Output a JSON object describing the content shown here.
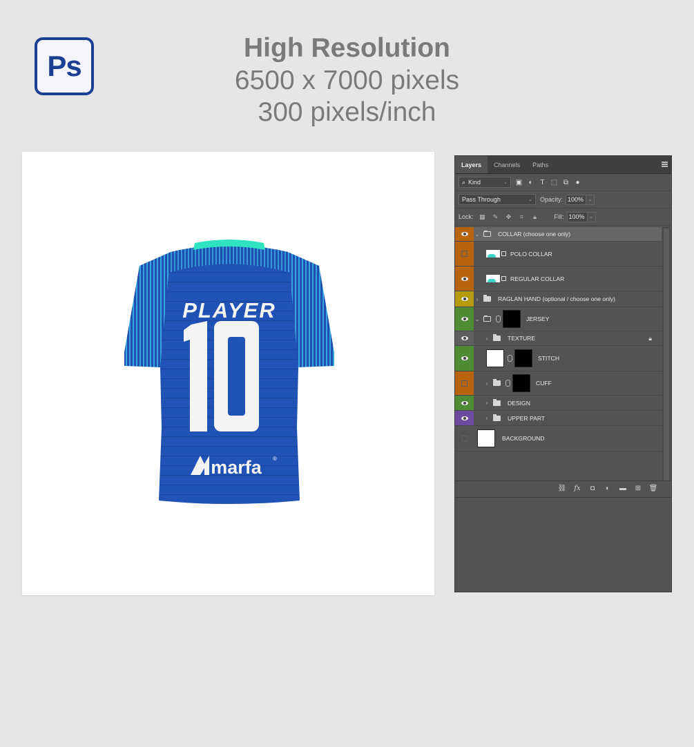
{
  "logo": {
    "text": "Ps",
    "color": "#1c3f94"
  },
  "headline": {
    "title": "High Resolution",
    "dimensions": "6500 x 7000 pixels",
    "resolution": "300 pixels/inch"
  },
  "jersey": {
    "name_text": "PLAYER",
    "number_text": "10",
    "brand_text": "marfa",
    "brand_mark": "®",
    "body_color": "#2050b4",
    "sleeve_color": "#2a7cc9",
    "collar_color": "#2fe3c0"
  },
  "layers_panel": {
    "tabs": [
      {
        "label": "Layers",
        "active": true
      },
      {
        "label": "Channels",
        "active": false
      },
      {
        "label": "Paths",
        "active": false
      }
    ],
    "filter": {
      "kind_label": "Kind"
    },
    "blend_mode": "Pass Through",
    "opacity_label": "Opacity:",
    "opacity_value": "100%",
    "lock_label": "Lock:",
    "fill_label": "Fill:",
    "fill_value": "100%",
    "layers": [
      {
        "name": "COLLAR (choose one only)",
        "visible": true,
        "tag_color": "#b8640c",
        "kind": "group-open",
        "selected": true
      },
      {
        "name": "POLO COLLAR",
        "visible": false,
        "tag_color": "#b8640c",
        "kind": "smart-object"
      },
      {
        "name": "REGULAR COLLAR",
        "visible": true,
        "tag_color": "#b8640c",
        "kind": "smart-object"
      },
      {
        "name": "RAGLAN HAND (optional / choose one only)",
        "visible": true,
        "tag_color": "#b59b0c",
        "kind": "group"
      },
      {
        "name": "JERSEY",
        "visible": true,
        "tag_color": "#4f8a35",
        "kind": "group-masked"
      },
      {
        "name": "TEXTURE",
        "visible": true,
        "tag_color": "#5f5f5f",
        "kind": "group-locked"
      },
      {
        "name": "STITCH",
        "visible": true,
        "tag_color": "#4f8a35",
        "kind": "layer-masked"
      },
      {
        "name": "CUFF",
        "visible": false,
        "tag_color": "#b8640c",
        "kind": "group-masked"
      },
      {
        "name": "DESIGN",
        "visible": true,
        "tag_color": "#4f8a35",
        "kind": "group"
      },
      {
        "name": "UPPER PART",
        "visible": true,
        "tag_color": "#6b4aa0",
        "kind": "group"
      },
      {
        "name": "BACKGROUND",
        "visible": false,
        "tag_color": "",
        "kind": "background"
      }
    ],
    "footer_icons": [
      "link-icon",
      "fx-icon",
      "mask-icon",
      "adjustment-icon",
      "new-group-icon",
      "new-layer-icon",
      "delete-icon"
    ]
  }
}
